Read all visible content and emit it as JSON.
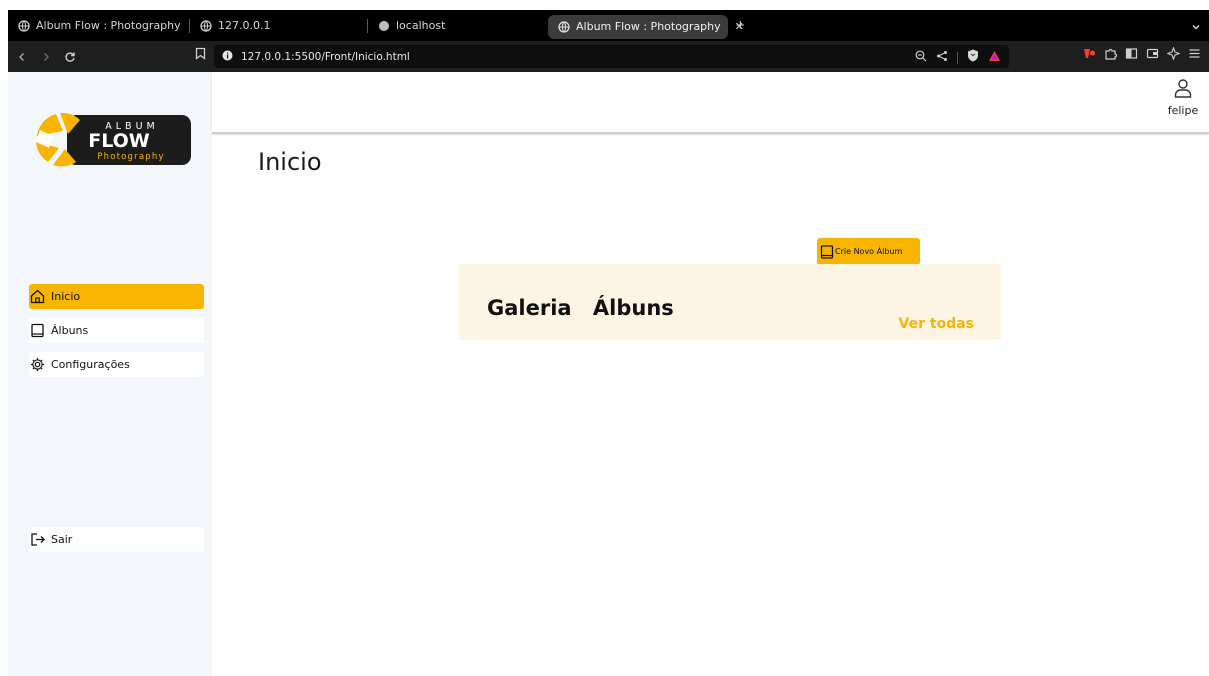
{
  "browser": {
    "tabs": [
      {
        "title": "Album Flow : Photography",
        "icon": "globe-icon"
      },
      {
        "title": "127.0.0.1",
        "icon": "globe-icon"
      },
      {
        "title": "localhost",
        "icon": "circle-icon"
      },
      {
        "title": "Album Flow : Photography",
        "icon": "globe-icon",
        "active": true
      }
    ],
    "new_tab_label": "+",
    "url": "127.0.0.1:5500/Front/Inicio.html"
  },
  "logo": {
    "line1": "ALBUM",
    "line2": "FLOW",
    "line3": "Photography"
  },
  "sidebar": {
    "items": [
      {
        "label": "Inicio",
        "icon": "home-icon",
        "active": true
      },
      {
        "label": "Álbuns",
        "icon": "book-icon"
      },
      {
        "label": "Configurações",
        "icon": "gear-icon"
      }
    ],
    "logout_label": "Sair",
    "logout_icon": "logout-icon"
  },
  "header": {
    "user_name": "felipe",
    "user_icon": "user-icon"
  },
  "main": {
    "title": "Inicio",
    "new_album_label": "Crie Novo Álbum",
    "gallery_title": "Galeria Álbuns",
    "see_all_label": "Ver todas"
  },
  "colors": {
    "accent": "#f9b400",
    "sidebar_bg": "#f3f6fa",
    "gallery_bg": "#fcf5e3"
  }
}
